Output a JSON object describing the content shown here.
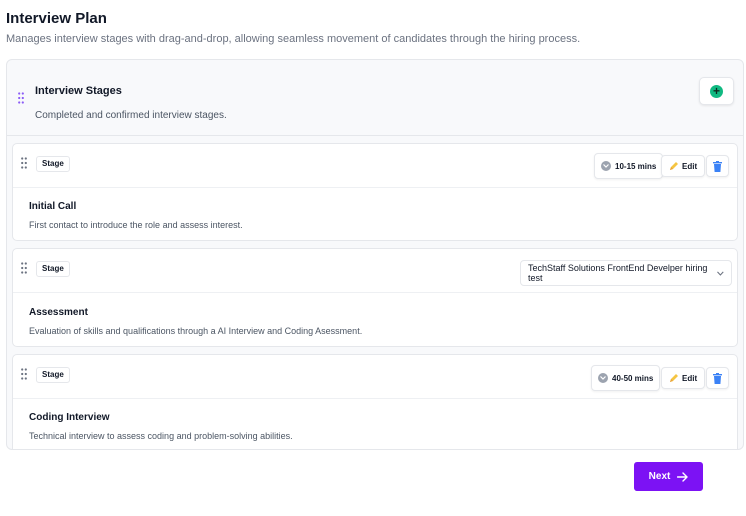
{
  "header": {
    "title": "Interview Plan",
    "subtitle": "Manages interview stages with drag-and-drop, allowing seamless movement of candidates through the hiring process."
  },
  "panel": {
    "title": "Interview Stages",
    "description": "Completed and confirmed interview stages.",
    "add_icon": "plus-circle-icon"
  },
  "stages": [
    {
      "tag": "Stage",
      "name": "Initial Call",
      "description": "First contact to introduce the role and assess interest.",
      "duration": "10-15 mins",
      "edit_label": "Edit"
    },
    {
      "tag": "Stage",
      "name": "Assessment",
      "description": "Evaluation of skills and qualifications through a AI Interview and Coding Asessment.",
      "selected_test": "TechStaff Solutions FrontEnd Develper hiring test"
    },
    {
      "tag": "Stage",
      "name": "Coding Interview",
      "description": "Technical interview to assess coding and problem-solving abilities.",
      "duration": "40-50 mins",
      "edit_label": "Edit"
    }
  ],
  "footer": {
    "next_label": "Next"
  },
  "colors": {
    "accent": "#7c12f4",
    "add": "#10b981",
    "delete": "#3b82f6",
    "grip_purple": "#8b5cf6"
  }
}
